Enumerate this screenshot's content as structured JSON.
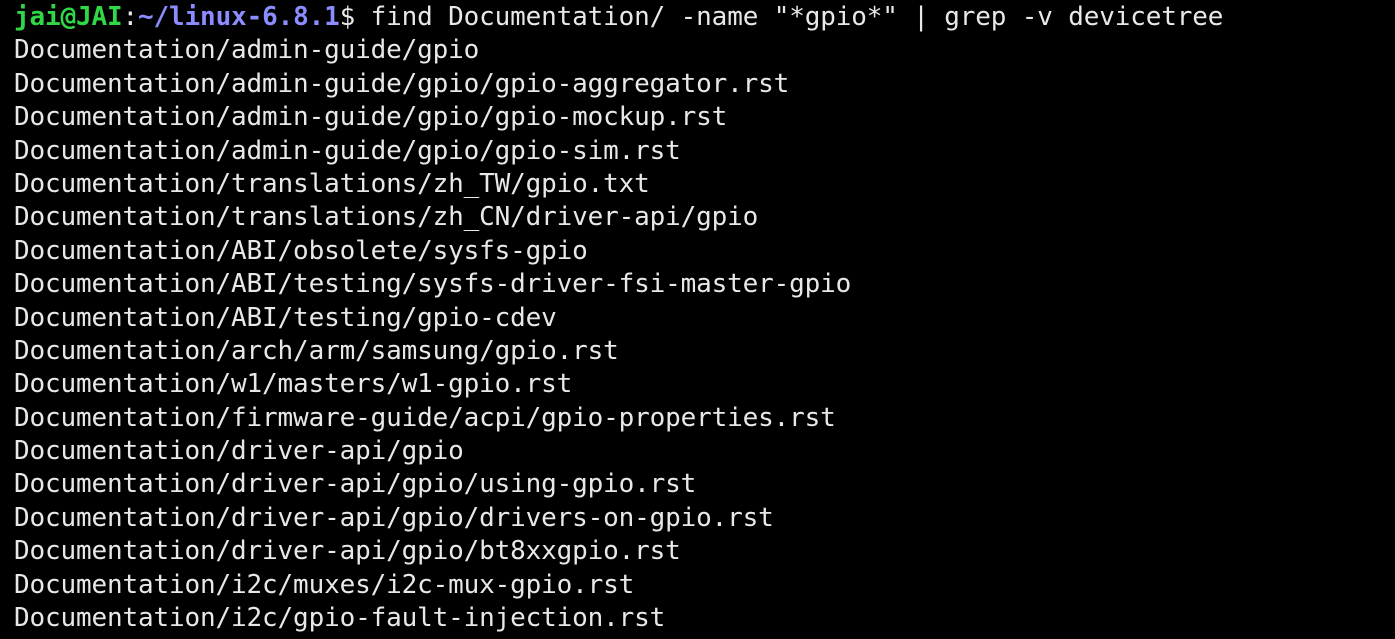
{
  "prompt": {
    "user_host": "jai@JAI",
    "separator": ":",
    "cwd": "~/linux-6.8.1",
    "symbol": "$",
    "command": " find Documentation/ -name \"*gpio*\" | grep -v devicetree"
  },
  "output": [
    "Documentation/admin-guide/gpio",
    "Documentation/admin-guide/gpio/gpio-aggregator.rst",
    "Documentation/admin-guide/gpio/gpio-mockup.rst",
    "Documentation/admin-guide/gpio/gpio-sim.rst",
    "Documentation/translations/zh_TW/gpio.txt",
    "Documentation/translations/zh_CN/driver-api/gpio",
    "Documentation/ABI/obsolete/sysfs-gpio",
    "Documentation/ABI/testing/sysfs-driver-fsi-master-gpio",
    "Documentation/ABI/testing/gpio-cdev",
    "Documentation/arch/arm/samsung/gpio.rst",
    "Documentation/w1/masters/w1-gpio.rst",
    "Documentation/firmware-guide/acpi/gpio-properties.rst",
    "Documentation/driver-api/gpio",
    "Documentation/driver-api/gpio/using-gpio.rst",
    "Documentation/driver-api/gpio/drivers-on-gpio.rst",
    "Documentation/driver-api/gpio/bt8xxgpio.rst",
    "Documentation/i2c/muxes/i2c-mux-gpio.rst",
    "Documentation/i2c/gpio-fault-injection.rst"
  ],
  "colors": {
    "background": "#000000",
    "text": "#e8e8e8",
    "user_host": "#31d846",
    "cwd": "#8a8cff"
  }
}
